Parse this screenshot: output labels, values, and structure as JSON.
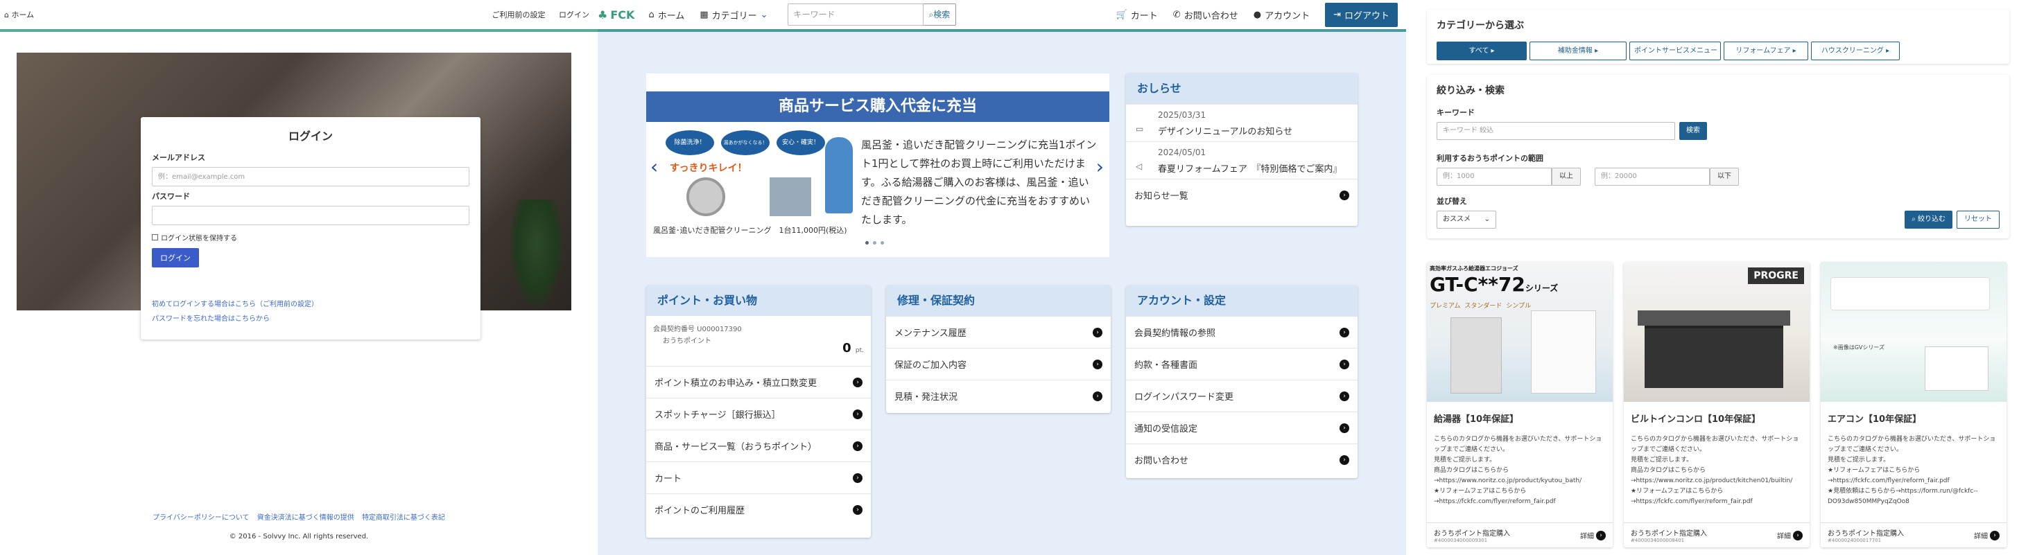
{
  "p1": {
    "header": {
      "home": "ホーム",
      "links": [
        "ご利用前の設定",
        "ログイン"
      ]
    },
    "login": {
      "title": "ログイン",
      "email_label": "メールアドレス",
      "email_placeholder": "例：email@example.com",
      "password_label": "パスワード",
      "remember": "ログイン状態を保持する",
      "button": "ログイン",
      "link_first": "初めてログインする場合はこちら（ご利用前の設定）",
      "link_forgot": "パスワードを忘れた場合はこちらから"
    },
    "footer": {
      "links": [
        "プライバシーポリシーについて",
        "資金決済法に基づく情報の提供",
        "特定商取引法に基づく表記"
      ],
      "copyright": "© 2016 - Solvvy Inc. All rights reserved."
    }
  },
  "p2": {
    "header": {
      "logo": "FCK",
      "home": "ホーム",
      "category": "カテゴリー",
      "search_placeholder": "キーワード",
      "search_button": "検索",
      "cart": "カート",
      "contact": "お問い合わせ",
      "account": "アカウント",
      "logout": "ログアウト"
    },
    "carousel": {
      "banner": "商品サービス購入代金に充当",
      "badges": [
        "除菌洗浄！",
        "湯あかがなくなる！",
        "安心・確実！"
      ],
      "slogan": "すっきりキレイ！",
      "text": "風呂釜・追いだき配管クリーニングに充当1ポイント1円として弊社のお買上時にご利用いただけます。ふる給湯器ご購入のお客様は、風呂釜・追いだき配管クリーニングの代金に充当をおすすめいたします。",
      "caption": "風呂釜･追いだき配管クリーニング　1台11,000円(税込)"
    },
    "news": {
      "title": "おしらせ",
      "items": [
        {
          "date": "2025/03/31",
          "text": "デザインリニューアルのお知らせ"
        },
        {
          "date": "2024/05/01",
          "text": "春夏リフォームフェア　『特別価格でご案内』"
        }
      ],
      "more": "お知らせ一覧"
    },
    "points_card": {
      "title": "ポイント・お買い物",
      "member_no": "会員契約番号 U000017390",
      "point_label": "おうちポイント",
      "points": "0",
      "unit": "pt.",
      "items": [
        "ポイント積立のお申込み・積立口数変更",
        "スポットチャージ［銀行振込］",
        "商品・サービス一覧（おうちポイント）",
        "カート",
        "ポイントのご利用履歴"
      ]
    },
    "repair_card": {
      "title": "修理・保証契約",
      "items": [
        "メンテナンス履歴",
        "保証のご加入内容",
        "見積・発注状況"
      ]
    },
    "account_card": {
      "title": "アカウント・設定",
      "items": [
        "会員契約情報の参照",
        "約款・各種書面",
        "ログインパスワード変更",
        "通知の受信設定",
        "お問い合わせ"
      ]
    }
  },
  "p3": {
    "category": {
      "title": "カテゴリーから選ぶ",
      "buttons": [
        "すべて ▸",
        "補助金情報 ▸",
        "ポイントサービスメニュー",
        "リフォームフェア ▸",
        "ハウスクリーニング ▸"
      ]
    },
    "filter": {
      "title": "絞り込み・検索",
      "keyword_label": "キーワード",
      "keyword_placeholder": "キーワード 絞込",
      "search": "検索",
      "range_label": "利用するおうちポイントの範囲",
      "min_placeholder": "例：1000",
      "min_suffix": "以上",
      "max_placeholder": "例：20000",
      "max_suffix": "以下",
      "sort_label": "並び替え",
      "sort_value": "おススメ",
      "apply": "絞り込む",
      "reset": "リセット"
    },
    "products": [
      {
        "name": "給湯器【10年保証】",
        "img_title": "GT-C**72",
        "img_sub": "シリーズ",
        "img_top": "高効率ガスふろ給湯器エコジョーズ",
        "img_tags": [
          "プレミアム",
          "スタンダード",
          "シンプル"
        ],
        "desc": [
          "こちらのカタログから機器をお選びいただき、サポートショップまでご連絡ください。",
          "見積をご提示します。",
          "商品カタログはこちらから→https://www.noritz.co.jp/product/kyutou_bath/",
          "★リフォームフェアはこちらから→https://fckfc.com/flyer/reform_fair.pdf"
        ],
        "tag": "おうちポイント指定購入",
        "code": "#4000034000009301",
        "detail": "詳細"
      },
      {
        "name": "ビルトインコンロ【10年保証】",
        "img_title": "PROGRE",
        "desc": [
          "こちらのカタログから機器をお選びいただき、サポートショップまでご連絡ください。",
          "見積をご提示します。",
          "商品カタログはこちらから→https://www.noritz.co.jp/product/kitchen01/builtin/",
          "★リフォームフェアはこちらから→https://fckfc.com/flyer/reform_fair.pdf"
        ],
        "tag": "おうちポイント指定購入",
        "code": "#4000034000008401",
        "detail": "詳細"
      },
      {
        "name": "エアコン【10年保証】",
        "img_note": "※画像はGVシリーズ",
        "desc": [
          "こちらのカタログから機器をお選びいただき、サポートショップまでご連絡ください。",
          "見積をご提示します。",
          "★リフォームフェアはこちらから→https://fckfc.com/flyer/reform_fair.pdf",
          "★見積依頼はこちらから→https://form.run/@fckfc--DO93dw850MMPyqZqOo8"
        ],
        "tag": "おうちポイント指定購入",
        "code": "#4000024000017701",
        "detail": "詳細"
      }
    ]
  }
}
